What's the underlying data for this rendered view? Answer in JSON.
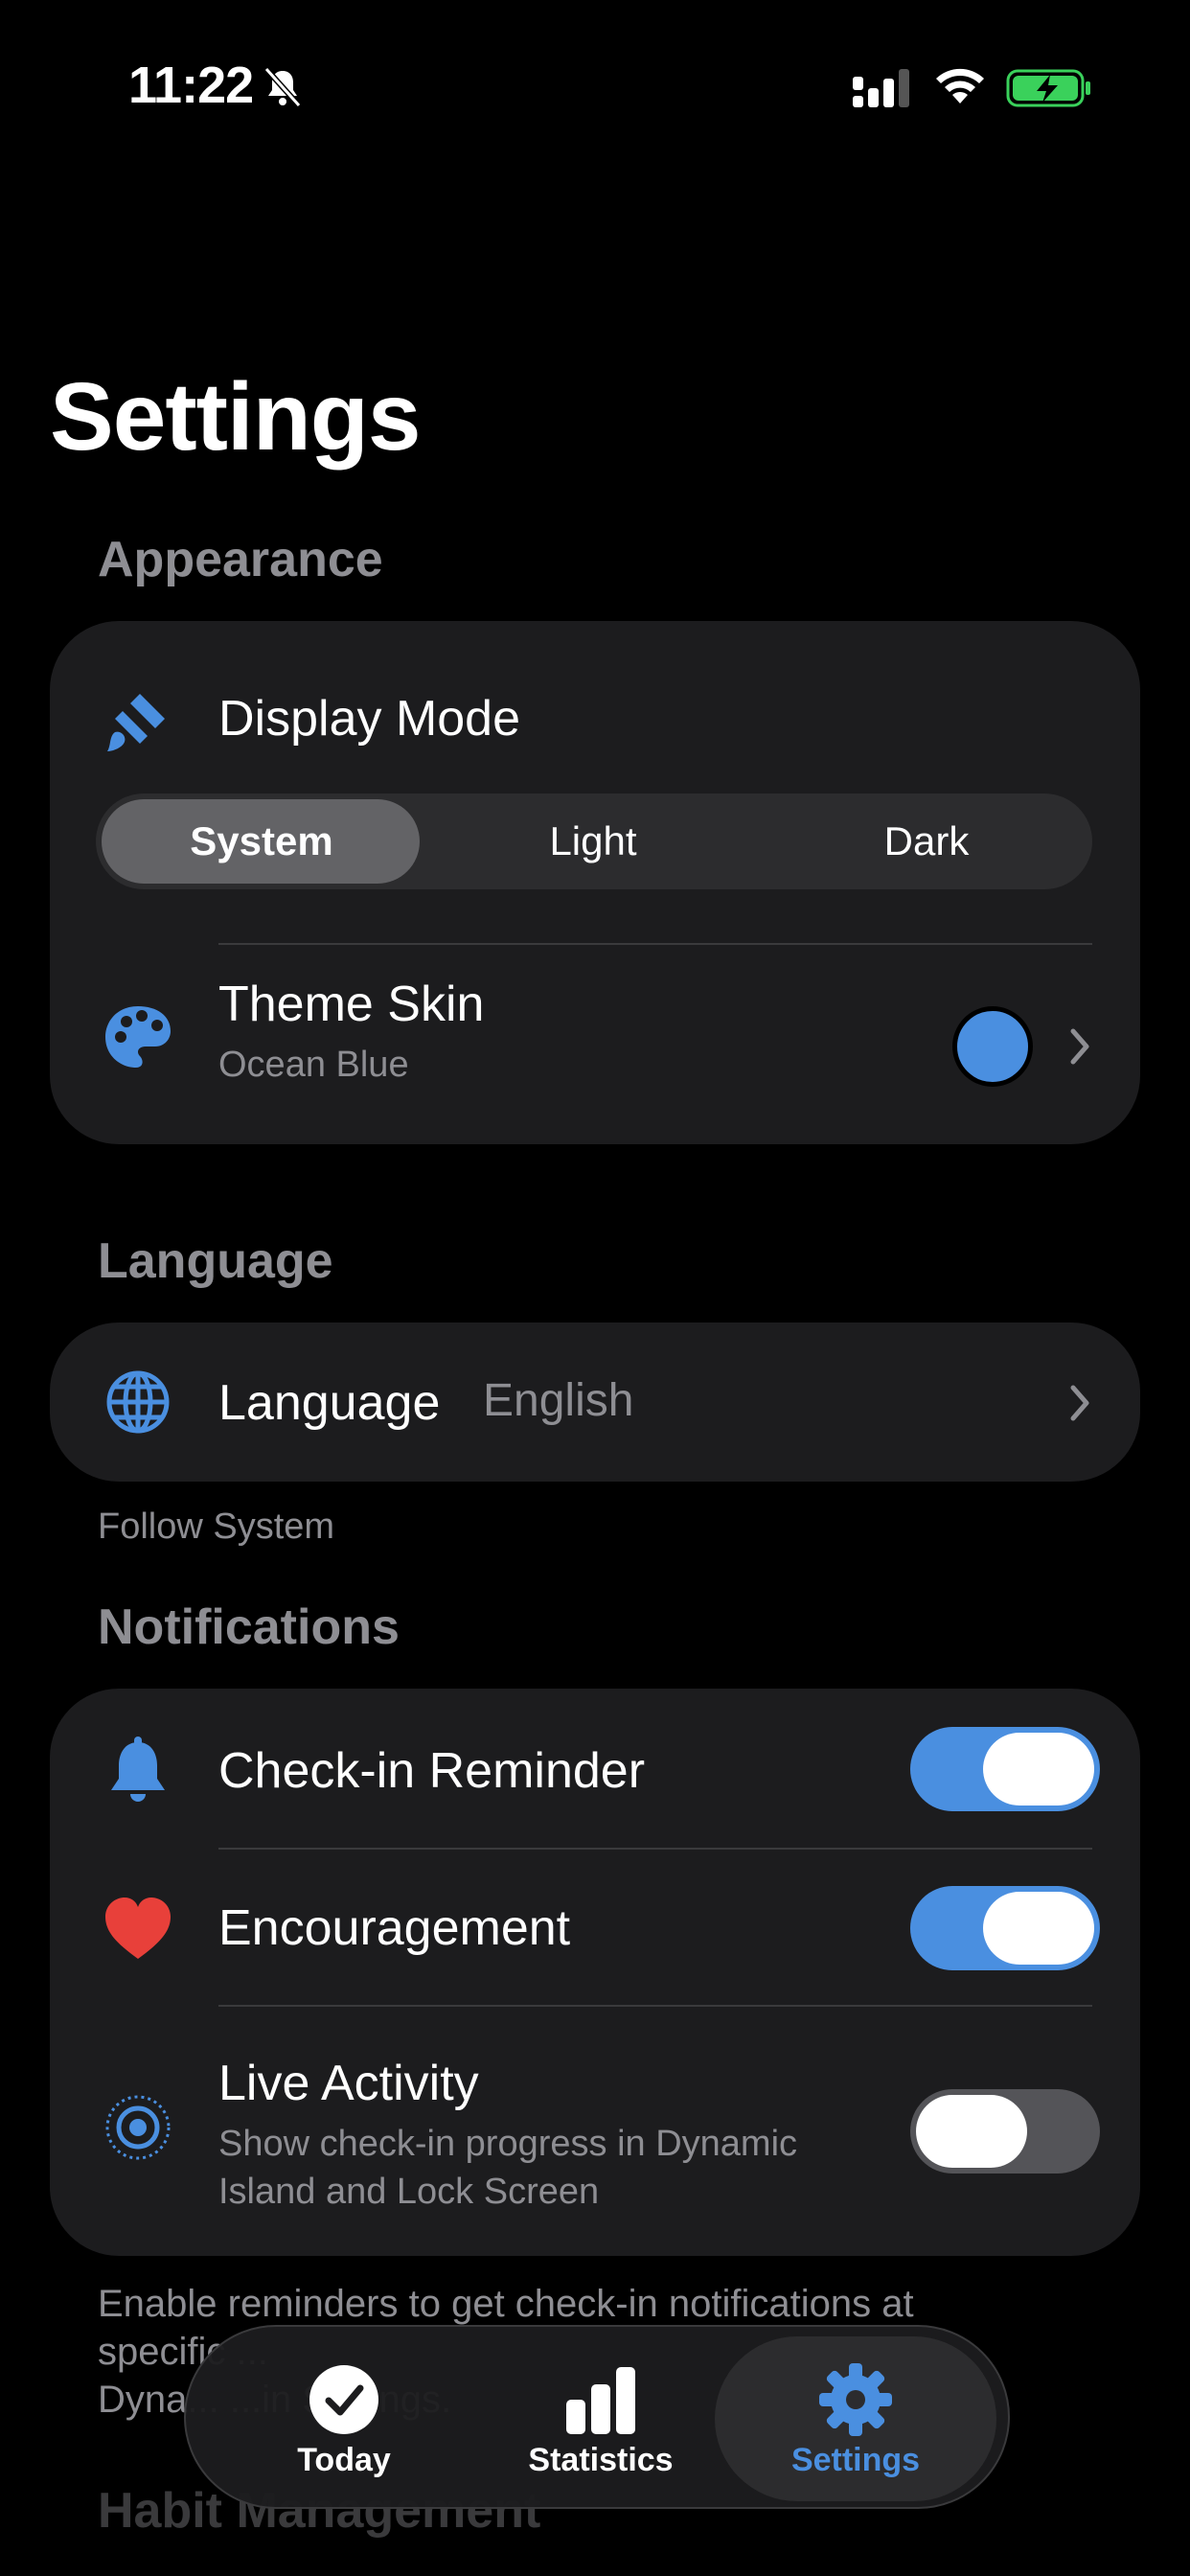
{
  "status_bar": {
    "time": "11:22",
    "icons": [
      "bell-slash-icon",
      "signal-icon",
      "wifi-icon",
      "battery-charging-icon"
    ]
  },
  "title": "Settings",
  "accent_color": "#4a8fe0",
  "appearance": {
    "header": "Appearance",
    "display_mode": {
      "label": "Display Mode",
      "icon": "paintbrush-icon",
      "options": [
        "System",
        "Light",
        "Dark"
      ],
      "selected": "System"
    },
    "theme_skin": {
      "label": "Theme Skin",
      "value": "Ocean Blue",
      "icon": "palette-icon",
      "swatch_color": "#4a8fe0"
    }
  },
  "language": {
    "header": "Language",
    "label": "Language",
    "value": "English",
    "icon": "globe-icon",
    "footnote": "Follow System"
  },
  "notifications": {
    "header": "Notifications",
    "items": [
      {
        "label": "Check-in Reminder",
        "icon": "bell-icon",
        "enabled": true
      },
      {
        "label": "Encouragement",
        "icon": "heart-icon",
        "enabled": true
      },
      {
        "label": "Live Activity",
        "subtitle_line1": "Show check-in progress in Dynamic",
        "subtitle_line2": "Island and Lock Screen",
        "icon": "live-activity-icon",
        "enabled": false
      }
    ],
    "footnote_line1": "Enable reminders to get check-in notifications at",
    "footnote_line2": "specific ...",
    "footnote_line3": "Dyna... ...in Settings."
  },
  "next_header": "Habit Management",
  "tab_bar": {
    "tabs": [
      {
        "label": "Today",
        "icon": "checkmark-circle-icon"
      },
      {
        "label": "Statistics",
        "icon": "bar-chart-icon"
      },
      {
        "label": "Settings",
        "icon": "gear-icon"
      }
    ],
    "selected": "Settings"
  }
}
